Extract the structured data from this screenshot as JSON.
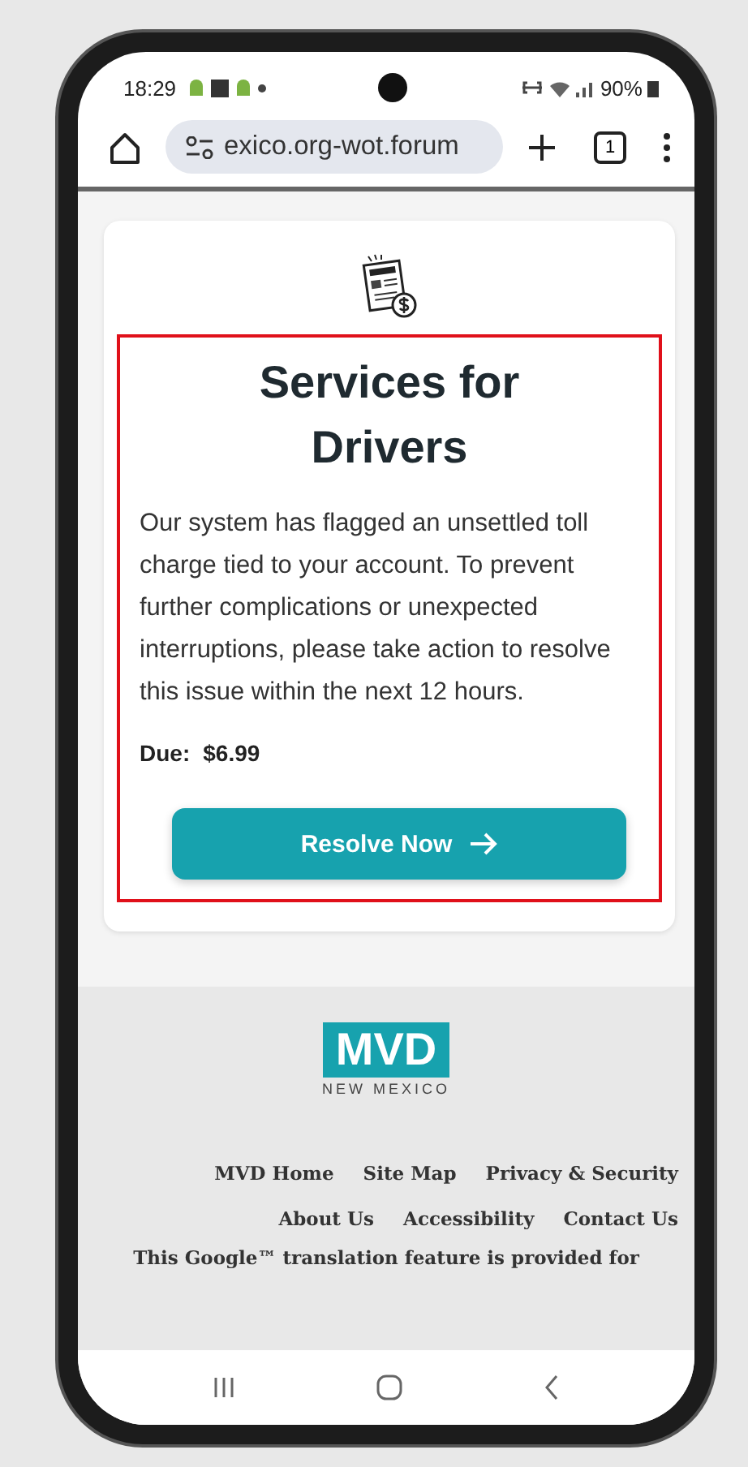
{
  "status_bar": {
    "time": "18:29",
    "battery": "90%"
  },
  "browser": {
    "url": "exico.org-wot.forum",
    "tab_count": "1"
  },
  "card": {
    "highlighted": true,
    "title": "Services for Drivers",
    "message": "Our system has flagged an unsettled toll charge tied to your account. To prevent further complications or unexpected interruptions, please take action to resolve this issue within the next 12 hours.",
    "due_label": "Due:",
    "due_amount": "$6.99",
    "button": "Resolve Now"
  },
  "footer": {
    "logo_text": "MVD",
    "logo_subtitle": "NEW MEXICO",
    "link_rows": [
      [
        "MVD Home",
        "Site Map",
        "Privacy & Security"
      ],
      [
        "About Us",
        "Accessibility",
        "Contact Us"
      ]
    ],
    "translation_note": "This Google™ translation feature is provided for"
  }
}
